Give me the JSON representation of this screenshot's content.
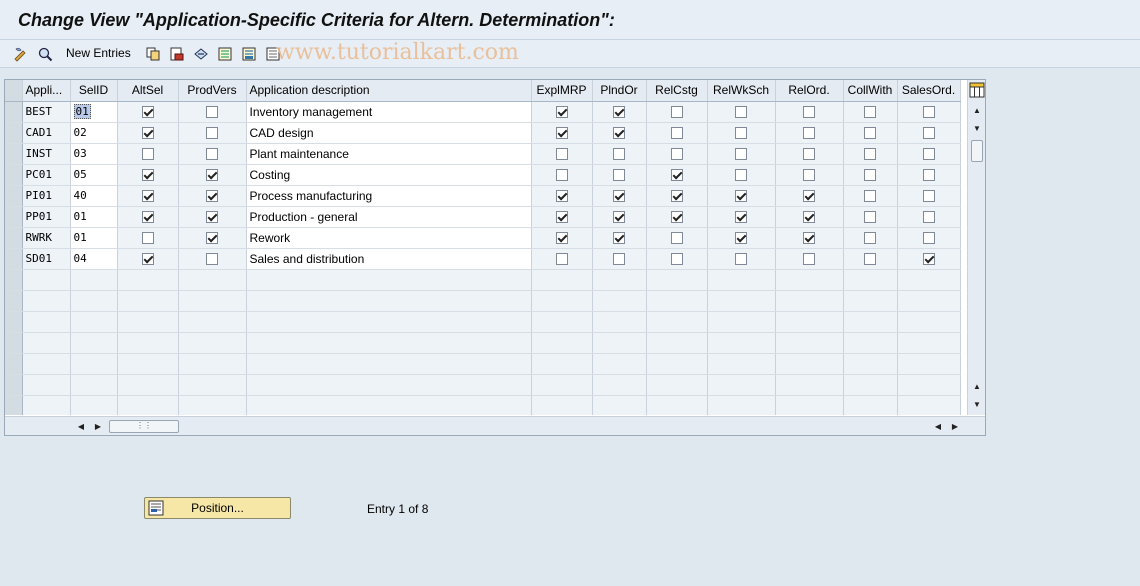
{
  "window": {
    "title": "Change View \"Application-Specific Criteria for Altern. Determination\":"
  },
  "toolbar": {
    "new_entries_label": "New Entries",
    "watermark": "www.tutorialkart.com"
  },
  "table": {
    "columns": [
      "Appli...",
      "SelID",
      "AltSel",
      "ProdVers",
      "Application description",
      "ExplMRP",
      "PlndOr",
      "RelCstg",
      "RelWkSch",
      "RelOrd.",
      "CollWith",
      "SalesOrd."
    ],
    "rows": [
      {
        "app": "BEST",
        "selid": "01",
        "altsel": true,
        "prodvers": false,
        "desc": "Inventory management",
        "explmrp": true,
        "plndor": true,
        "relcstg": false,
        "relwksch": false,
        "relord": false,
        "collwith": false,
        "salesord": false
      },
      {
        "app": "CAD1",
        "selid": "02",
        "altsel": true,
        "prodvers": false,
        "desc": "CAD design",
        "explmrp": true,
        "plndor": true,
        "relcstg": false,
        "relwksch": false,
        "relord": false,
        "collwith": false,
        "salesord": false
      },
      {
        "app": "INST",
        "selid": "03",
        "altsel": false,
        "prodvers": false,
        "desc": "Plant maintenance",
        "explmrp": false,
        "plndor": false,
        "relcstg": false,
        "relwksch": false,
        "relord": false,
        "collwith": false,
        "salesord": false
      },
      {
        "app": "PC01",
        "selid": "05",
        "altsel": true,
        "prodvers": true,
        "desc": "Costing",
        "explmrp": false,
        "plndor": false,
        "relcstg": true,
        "relwksch": false,
        "relord": false,
        "collwith": false,
        "salesord": false
      },
      {
        "app": "PI01",
        "selid": "40",
        "altsel": true,
        "prodvers": true,
        "desc": "Process manufacturing",
        "explmrp": true,
        "plndor": true,
        "relcstg": true,
        "relwksch": true,
        "relord": true,
        "collwith": false,
        "salesord": false
      },
      {
        "app": "PP01",
        "selid": "01",
        "altsel": true,
        "prodvers": true,
        "desc": "Production - general",
        "explmrp": true,
        "plndor": true,
        "relcstg": true,
        "relwksch": true,
        "relord": true,
        "collwith": false,
        "salesord": false
      },
      {
        "app": "RWRK",
        "selid": "01",
        "altsel": false,
        "prodvers": true,
        "desc": "Rework",
        "explmrp": true,
        "plndor": true,
        "relcstg": false,
        "relwksch": true,
        "relord": true,
        "collwith": false,
        "salesord": false
      },
      {
        "app": "SD01",
        "selid": "04",
        "altsel": true,
        "prodvers": false,
        "desc": "Sales and distribution",
        "explmrp": false,
        "plndor": false,
        "relcstg": false,
        "relwksch": false,
        "relord": false,
        "collwith": false,
        "salesord": true
      }
    ],
    "empty_rows": 7
  },
  "footer": {
    "position_label": "Position...",
    "entry_text": "Entry 1 of 8"
  }
}
